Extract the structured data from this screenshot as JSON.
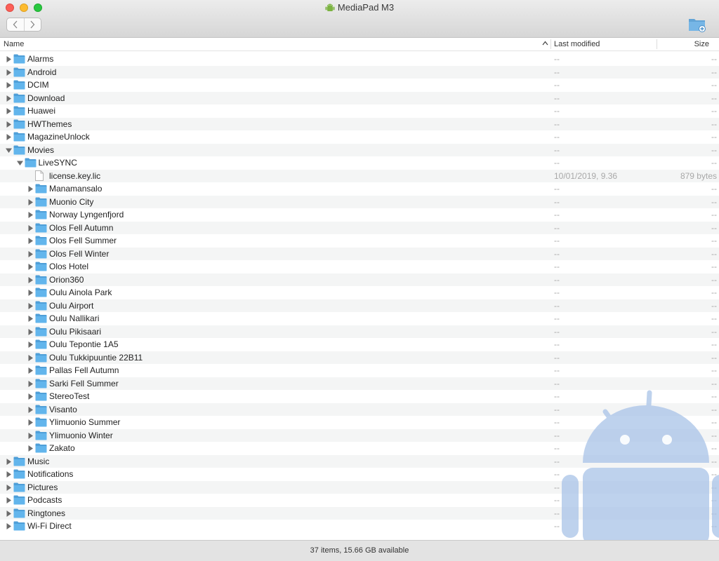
{
  "window": {
    "title": "MediaPad M3"
  },
  "columns": {
    "name": "Name",
    "modified": "Last modified",
    "size": "Size"
  },
  "rows": [
    {
      "name": "Alarms",
      "level": 0,
      "type": "folder",
      "expanded": false,
      "modified": "--",
      "size": "--"
    },
    {
      "name": "Android",
      "level": 0,
      "type": "folder",
      "expanded": false,
      "modified": "--",
      "size": "--"
    },
    {
      "name": "DCIM",
      "level": 0,
      "type": "folder",
      "expanded": false,
      "modified": "--",
      "size": "--"
    },
    {
      "name": "Download",
      "level": 0,
      "type": "folder",
      "expanded": false,
      "modified": "--",
      "size": "--"
    },
    {
      "name": "Huawei",
      "level": 0,
      "type": "folder",
      "expanded": false,
      "modified": "--",
      "size": "--"
    },
    {
      "name": "HWThemes",
      "level": 0,
      "type": "folder",
      "expanded": false,
      "modified": "--",
      "size": "--"
    },
    {
      "name": "MagazineUnlock",
      "level": 0,
      "type": "folder",
      "expanded": false,
      "modified": "--",
      "size": "--"
    },
    {
      "name": "Movies",
      "level": 0,
      "type": "folder",
      "expanded": true,
      "modified": "--",
      "size": "--"
    },
    {
      "name": "LiveSYNC",
      "level": 1,
      "type": "folder",
      "expanded": true,
      "modified": "--",
      "size": "--"
    },
    {
      "name": "license.key.lic",
      "level": 2,
      "type": "file",
      "expanded": false,
      "modified": "10/01/2019, 9.36",
      "size": "879 bytes"
    },
    {
      "name": "Manamansalo",
      "level": 2,
      "type": "folder",
      "expanded": false,
      "modified": "--",
      "size": "--"
    },
    {
      "name": "Muonio City",
      "level": 2,
      "type": "folder",
      "expanded": false,
      "modified": "--",
      "size": "--"
    },
    {
      "name": "Norway Lyngenfjord",
      "level": 2,
      "type": "folder",
      "expanded": false,
      "modified": "--",
      "size": "--"
    },
    {
      "name": "Olos Fell Autumn",
      "level": 2,
      "type": "folder",
      "expanded": false,
      "modified": "--",
      "size": "--"
    },
    {
      "name": "Olos Fell Summer",
      "level": 2,
      "type": "folder",
      "expanded": false,
      "modified": "--",
      "size": "--"
    },
    {
      "name": "Olos Fell Winter",
      "level": 2,
      "type": "folder",
      "expanded": false,
      "modified": "--",
      "size": "--"
    },
    {
      "name": "Olos Hotel",
      "level": 2,
      "type": "folder",
      "expanded": false,
      "modified": "--",
      "size": "--"
    },
    {
      "name": "Orion360",
      "level": 2,
      "type": "folder",
      "expanded": false,
      "modified": "--",
      "size": "--"
    },
    {
      "name": "Oulu Ainola Park",
      "level": 2,
      "type": "folder",
      "expanded": false,
      "modified": "--",
      "size": "--"
    },
    {
      "name": "Oulu Airport",
      "level": 2,
      "type": "folder",
      "expanded": false,
      "modified": "--",
      "size": "--"
    },
    {
      "name": "Oulu Nallikari",
      "level": 2,
      "type": "folder",
      "expanded": false,
      "modified": "--",
      "size": "--"
    },
    {
      "name": "Oulu Pikisaari",
      "level": 2,
      "type": "folder",
      "expanded": false,
      "modified": "--",
      "size": "--"
    },
    {
      "name": "Oulu Tepontie 1A5",
      "level": 2,
      "type": "folder",
      "expanded": false,
      "modified": "--",
      "size": "--"
    },
    {
      "name": "Oulu Tukkipuuntie 22B11",
      "level": 2,
      "type": "folder",
      "expanded": false,
      "modified": "--",
      "size": "--"
    },
    {
      "name": "Pallas Fell Autumn",
      "level": 2,
      "type": "folder",
      "expanded": false,
      "modified": "--",
      "size": "--"
    },
    {
      "name": "Sarki Fell Summer",
      "level": 2,
      "type": "folder",
      "expanded": false,
      "modified": "--",
      "size": "--"
    },
    {
      "name": "StereoTest",
      "level": 2,
      "type": "folder",
      "expanded": false,
      "modified": "--",
      "size": "--"
    },
    {
      "name": "Visanto",
      "level": 2,
      "type": "folder",
      "expanded": false,
      "modified": "--",
      "size": "--"
    },
    {
      "name": "Ylimuonio Summer",
      "level": 2,
      "type": "folder",
      "expanded": false,
      "modified": "--",
      "size": "--"
    },
    {
      "name": "Ylimuonio Winter",
      "level": 2,
      "type": "folder",
      "expanded": false,
      "modified": "--",
      "size": "--"
    },
    {
      "name": "Zakato",
      "level": 2,
      "type": "folder",
      "expanded": false,
      "modified": "--",
      "size": "--"
    },
    {
      "name": "Music",
      "level": 0,
      "type": "folder",
      "expanded": false,
      "modified": "--",
      "size": "--"
    },
    {
      "name": "Notifications",
      "level": 0,
      "type": "folder",
      "expanded": false,
      "modified": "--",
      "size": "--"
    },
    {
      "name": "Pictures",
      "level": 0,
      "type": "folder",
      "expanded": false,
      "modified": "--",
      "size": "--"
    },
    {
      "name": "Podcasts",
      "level": 0,
      "type": "folder",
      "expanded": false,
      "modified": "--",
      "size": "--"
    },
    {
      "name": "Ringtones",
      "level": 0,
      "type": "folder",
      "expanded": false,
      "modified": "--",
      "size": "--"
    },
    {
      "name": "Wi-Fi Direct",
      "level": 0,
      "type": "folder",
      "expanded": false,
      "modified": "--",
      "size": "--"
    }
  ],
  "status": {
    "text": "37 items, 15.66 GB available"
  },
  "icons": {
    "app": "android-app-icon",
    "back": "chevron-left-icon",
    "forward": "chevron-right-icon",
    "new_folder": "new-folder-icon",
    "sort": "sort-ascending-icon",
    "folder": "folder-icon",
    "file": "document-icon",
    "expanded": "disclosure-triangle-down-icon",
    "collapsed": "disclosure-triangle-right-icon",
    "watermark": "android-robot-icon"
  },
  "colors": {
    "folder": "#62b5ec",
    "watermark": "#a9c3e8",
    "traffic_close": "#fc5f57",
    "traffic_min": "#fdbb2e",
    "traffic_max": "#28c840"
  }
}
